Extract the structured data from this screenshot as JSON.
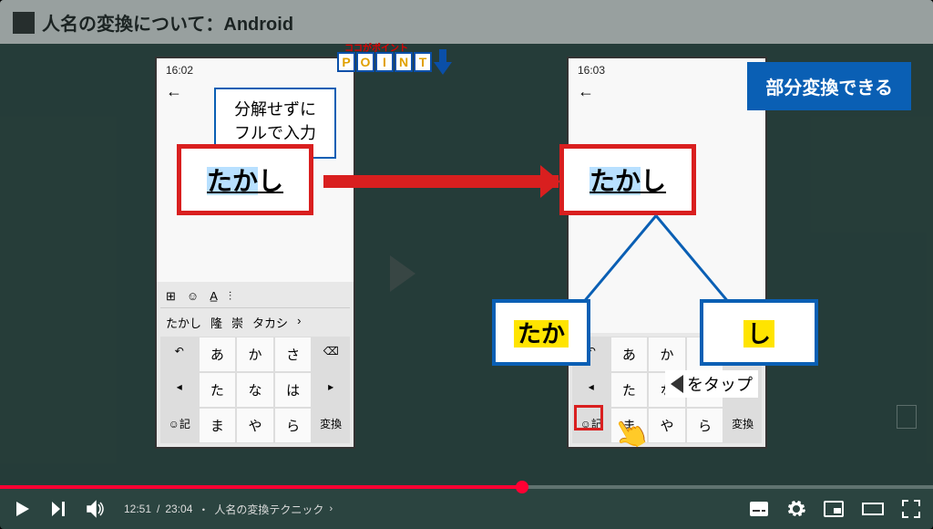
{
  "slide": {
    "title": "人名の変換について：Android",
    "point_ruby": "ココがポイント",
    "point_letters": [
      "P",
      "O",
      "I",
      "N",
      "T"
    ],
    "blue_banner": "部分変換できる",
    "bubble_line1": "分解せずに",
    "bubble_line2": "フルで入力",
    "left_text_hl": "たか",
    "left_text_rest": "し",
    "right_text_hl": "たか",
    "right_text_rest": "し",
    "blue_box1": "たか",
    "blue_box2": "し",
    "tap_label": "をタップ"
  },
  "phone": {
    "time_left": "16:02",
    "time_right": "16:03",
    "input_hint": "た",
    "sugg": [
      "たかし",
      "隆",
      "崇",
      "タカシ"
    ],
    "row1": [
      "あ",
      "か",
      "さ"
    ],
    "row2": [
      "た",
      "な",
      "は"
    ],
    "row3": [
      "ま",
      "や",
      "ら"
    ],
    "side_del": "⌫",
    "side_space": "変換",
    "emoji": "☺記",
    "back_key": "◂",
    "undo": "↶",
    "top_icons": [
      "⊞",
      "☺",
      "A̲",
      "⫶"
    ]
  },
  "player": {
    "current": "12:51",
    "duration": "23:04",
    "separator": "/",
    "chapter_prefix": "・",
    "chapter": "人名の変換テクニック",
    "chevron": "›",
    "progress_pct": 56
  }
}
